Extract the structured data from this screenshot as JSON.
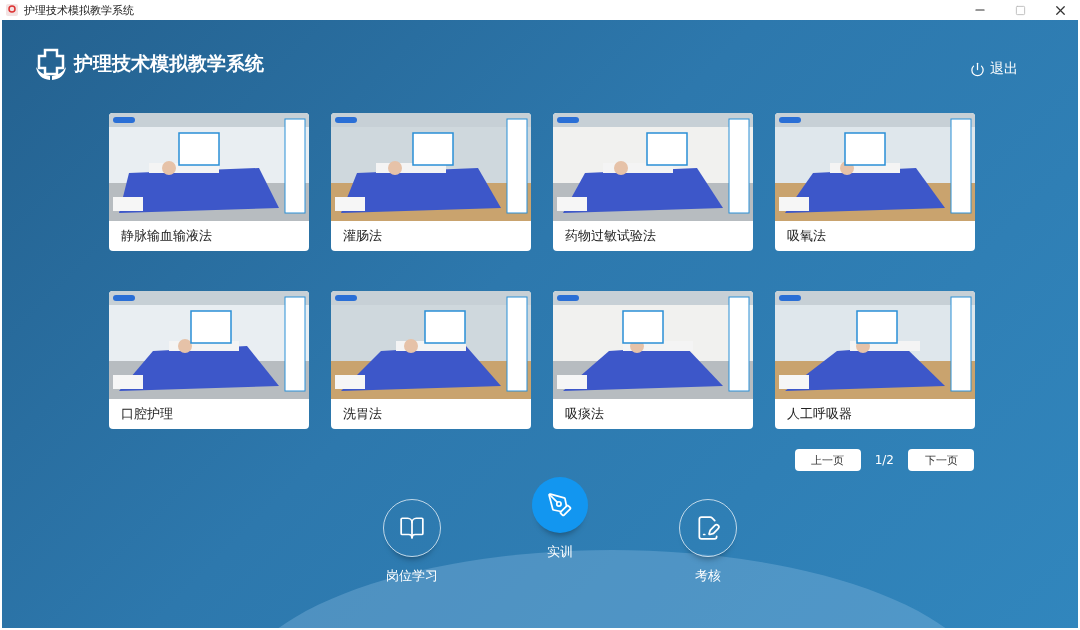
{
  "window": {
    "title": "护理技术模拟教学系统"
  },
  "header": {
    "app_name": "护理技术模拟教学系统",
    "logout": "退出"
  },
  "cards": [
    {
      "label": "静脉输血输液法"
    },
    {
      "label": "灌肠法"
    },
    {
      "label": "药物过敏试验法"
    },
    {
      "label": "吸氧法"
    },
    {
      "label": "口腔护理"
    },
    {
      "label": "洗胃法"
    },
    {
      "label": "吸痰法"
    },
    {
      "label": "人工呼吸器"
    }
  ],
  "pager": {
    "prev": "上一页",
    "page": "1/2",
    "next": "下一页"
  },
  "nav": [
    {
      "label": "岗位学习",
      "kind": "book",
      "selected": false
    },
    {
      "label": "实训",
      "kind": "pen",
      "selected": true
    },
    {
      "label": "考核",
      "kind": "exam",
      "selected": false
    }
  ]
}
